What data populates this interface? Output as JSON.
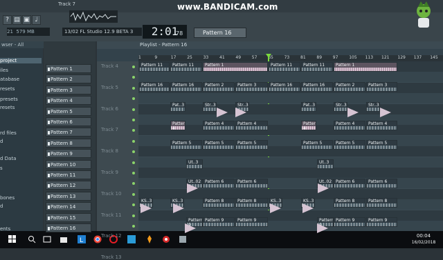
{
  "app": {
    "track_label": "Track 7",
    "hint_text": "13/02  FL Studio 12.9 BETA 3",
    "cpu_value": "21",
    "ram_value": "579 MB",
    "time": "2:01",
    "time_sub": "78",
    "pattern_selector": "Pattern 16",
    "watermark": "www.BANDICAM.com"
  },
  "browser": {
    "header": "wser - All",
    "items": [
      "project",
      "iles",
      "atabase",
      "resets",
      "presets",
      "resets",
      "rd files",
      "d",
      "d Data",
      "s",
      "bones",
      "d",
      "ents"
    ]
  },
  "channels": [
    "Pattern 1",
    "Pattern 2",
    "Pattern 3",
    "Pattern 4",
    "Pattern 5",
    "Pattern 6",
    "Pattern 7",
    "Pattern 8",
    "Pattern 9",
    "Pattern 10",
    "Pattern 11",
    "Pattern 12",
    "Pattern 13",
    "Pattern 14",
    "Pattern 15",
    "Pattern 16"
  ],
  "playlist": {
    "title": "Playlist - Pattern 16",
    "ruler_ticks": [
      "1",
      "9",
      "17",
      "25",
      "33",
      "41",
      "49",
      "57",
      "65",
      "73",
      "81",
      "89",
      "97",
      "105",
      "113",
      "121",
      "129",
      "137",
      "145"
    ],
    "tracks": [
      "Track 4",
      "Track 5",
      "Track 6",
      "Track 7",
      "Track 8",
      "Track 9",
      "Track 10",
      "Track 11",
      "Track 12",
      "Track 13"
    ]
  },
  "clip_labels": {
    "p11": "Pattern 11",
    "p16": "Pattern 16",
    "p1": "Pattern 1",
    "p2": "Pattern 2",
    "p3": "Pattern 3",
    "p4": "Pattern 4",
    "p5": "Pattern 5",
    "p6": "Pattern 6",
    "p8": "Pattern 8",
    "p9": "Pattern 9",
    "pat": "Pat..3",
    "str": "Str..3",
    "ut": "Ut..3",
    "ut2": "Ut..02",
    "ks": "KS..3",
    "ks2": "KS..3"
  },
  "taskbar": {
    "time": "00:04",
    "date": "16/02/2018"
  },
  "colors": {
    "playhead": "#7bdb3d",
    "clip_pink": "#b599ad"
  }
}
